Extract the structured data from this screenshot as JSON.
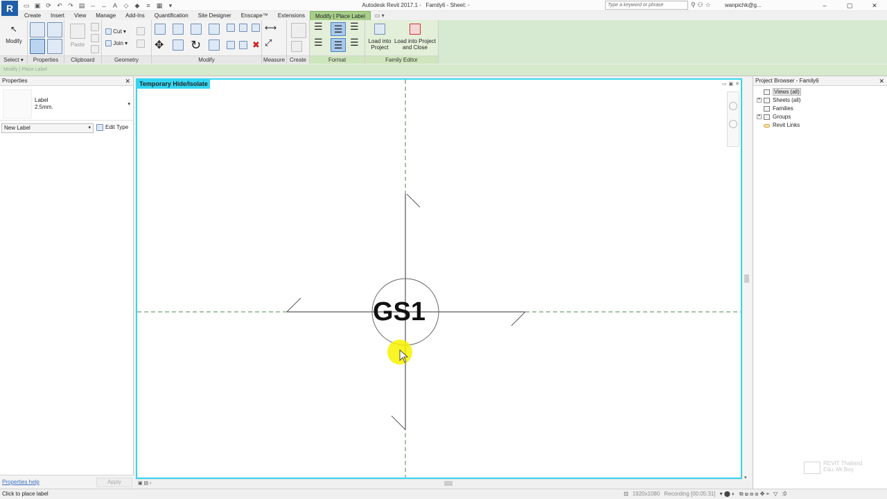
{
  "app": {
    "logo": "R",
    "title": "Autodesk Revit 2017.1 -",
    "doc_title": "Family6 - Sheet: -",
    "search_placeholder": "Type a keyword or phrase",
    "user": "wanpichk@g...",
    "qat_icons": [
      "open-icon",
      "save-icon",
      "sync-icon",
      "undo-icon",
      "redo-icon",
      "print-icon",
      "measure-icon",
      "dimension-icon",
      "text-icon",
      "3d-view-icon",
      "section-icon",
      "thin-lines-icon",
      "close-hidden-icon",
      "switch-windows-icon"
    ]
  },
  "tabs": [
    {
      "label": "Create"
    },
    {
      "label": "Insert"
    },
    {
      "label": "View"
    },
    {
      "label": "Manage"
    },
    {
      "label": "Add-Ins"
    },
    {
      "label": "Quantification"
    },
    {
      "label": "Site Designer"
    },
    {
      "label": "Enscape™"
    },
    {
      "label": "Extensions"
    },
    {
      "label": "Modify | Place Label",
      "active": true
    }
  ],
  "ribbon": {
    "select": {
      "modify_label": "Modify",
      "title": "Select ▾"
    },
    "properties": {
      "title": "Properties"
    },
    "clipboard": {
      "paste_label": "Paste",
      "title": "Clipboard"
    },
    "geometry": {
      "cut_label": "Cut",
      "join_label": "Join",
      "title": "Geometry"
    },
    "modify": {
      "title": "Modify"
    },
    "measure": {
      "title": "Measure"
    },
    "create": {
      "title": "Create"
    },
    "format": {
      "title": "Format"
    },
    "family_editor": {
      "load_into_project": "Load into Project",
      "load_and_close": "Load into Project and Close",
      "title": "Family Editor"
    }
  },
  "context_bar": {
    "text": "Modify | Place Label"
  },
  "properties_panel": {
    "title": "Properties",
    "type_name": "Label",
    "type_size": "2.5mm.",
    "instance_selector": "New Label",
    "edit_type": "Edit Type",
    "help_link": "Properties help",
    "apply_label": "Apply"
  },
  "canvas": {
    "temp_hide_label": "Temporary Hide/Isolate",
    "tag_text": "GS1"
  },
  "project_browser": {
    "title": "Project Browser - Family6",
    "items": [
      {
        "label": "Views (all)",
        "icon": "views-icon",
        "expand": ""
      },
      {
        "label": "Sheets (all)",
        "icon": "sheets-icon",
        "expand": "+"
      },
      {
        "label": "Families",
        "icon": "families-icon",
        "expand": ""
      },
      {
        "label": "Groups",
        "icon": "groups-icon",
        "expand": "+"
      },
      {
        "label": "Revit Links",
        "icon": "revit-links-icon",
        "expand": ""
      }
    ]
  },
  "watermark": {
    "line1": "REVIT Thailand",
    "line2": "Edu. Mr.Boy"
  },
  "status": {
    "text": "Click to place label",
    "resolution": "1920x1080",
    "recording": "Recording [00:05:31]",
    "filter_count": ":0"
  }
}
